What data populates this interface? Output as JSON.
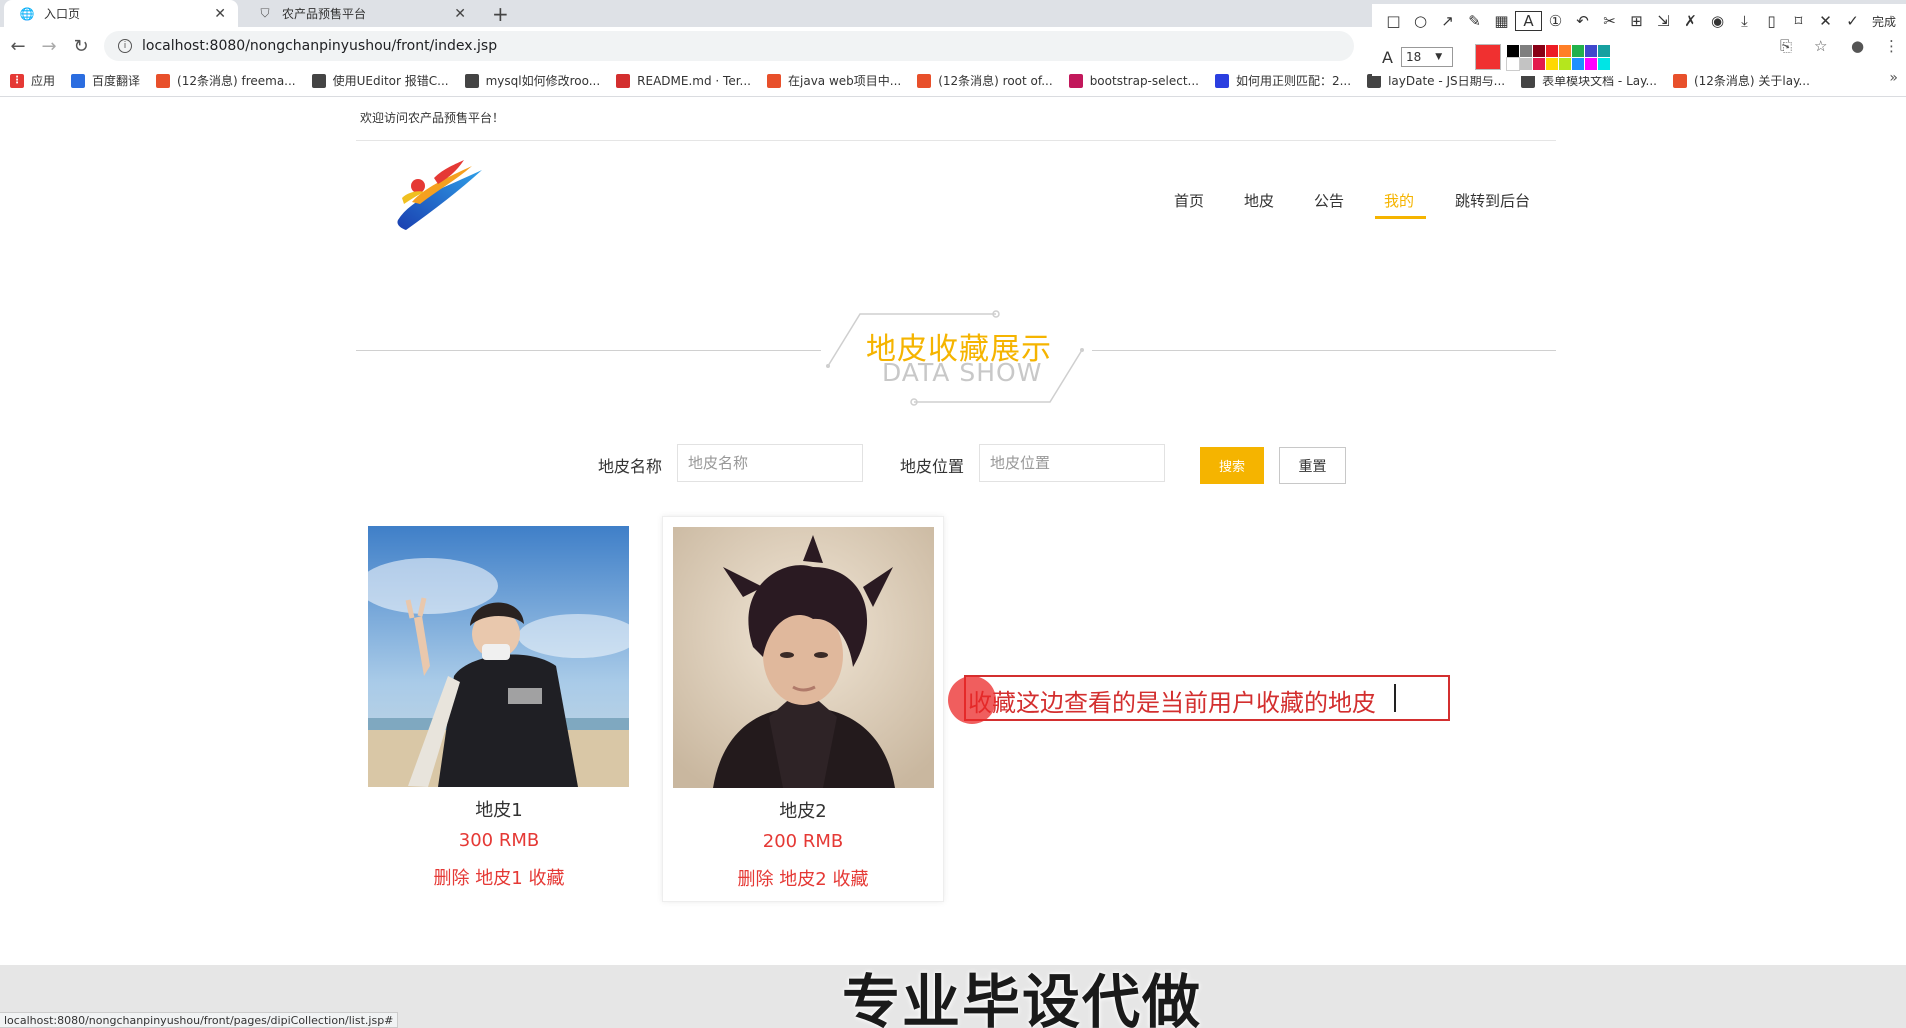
{
  "browser": {
    "tabs": [
      {
        "label": "入口页",
        "active": true
      },
      {
        "label": "农产品预售平台",
        "active": false
      }
    ],
    "url": "localhost:8080/nongchanpinyushou/front/index.jsp",
    "bookmarks": [
      {
        "label": "应用",
        "color": "#e53935",
        "icon": "apps-icon"
      },
      {
        "label": "百度翻译",
        "color": "#2b6de0",
        "icon": "translate-icon"
      },
      {
        "label": "(12条消息) freema...",
        "color": "#e8502b",
        "icon": "csdn-icon"
      },
      {
        "label": "使用UEditor 报错C...",
        "color": "#444444",
        "icon": "link-icon"
      },
      {
        "label": "mysql如何修改roo...",
        "color": "#444444",
        "icon": "link-icon"
      },
      {
        "label": "README.md · Ter...",
        "color": "#d32f2f",
        "icon": "gitee-icon"
      },
      {
        "label": "在java web项目中...",
        "color": "#e8502b",
        "icon": "csdn-icon"
      },
      {
        "label": "(12条消息) root of...",
        "color": "#e8502b",
        "icon": "csdn-icon"
      },
      {
        "label": "bootstrap-select...",
        "color": "#c2185b",
        "icon": "link-icon"
      },
      {
        "label": "如何用正则匹配：2...",
        "color": "#2b3fe0",
        "icon": "baidu-icon"
      },
      {
        "label": "layDate - JS日期与...",
        "color": "#444444",
        "icon": "layui-icon"
      },
      {
        "label": "表单模块文档 - Lay...",
        "color": "#444444",
        "icon": "layui-icon"
      },
      {
        "label": "(12条消息) 关于lay...",
        "color": "#e8502b",
        "icon": "csdn-icon"
      }
    ]
  },
  "screenshot_tool": {
    "font_size": "18",
    "done_label": "完成",
    "current_color": "#f03030"
  },
  "page": {
    "welcome": "欢迎访问农产品预售平台！",
    "nav": [
      "首页",
      "地皮",
      "公告",
      "我的",
      "跳转到后台"
    ],
    "active_nav": "我的",
    "section_title": "地皮收藏展示",
    "section_subtitle": "DATA SHOW",
    "search": {
      "name_label": "地皮名称",
      "name_placeholder": "地皮名称",
      "location_label": "地皮位置",
      "location_placeholder": "地皮位置",
      "search_button": "搜索",
      "reset_button": "重置"
    },
    "cards": [
      {
        "name": "地皮1",
        "price": "300 RMB",
        "action": "删除 地皮1 收藏"
      },
      {
        "name": "地皮2",
        "price": "200 RMB",
        "action": "删除 地皮2 收藏"
      }
    ],
    "annotation": "收藏这边查看的是当前用户收藏的地皮",
    "watermark": "专业毕设代做",
    "status_url": "localhost:8080/nongchanpinyushou/front/pages/dipiCollection/list.jsp#"
  }
}
